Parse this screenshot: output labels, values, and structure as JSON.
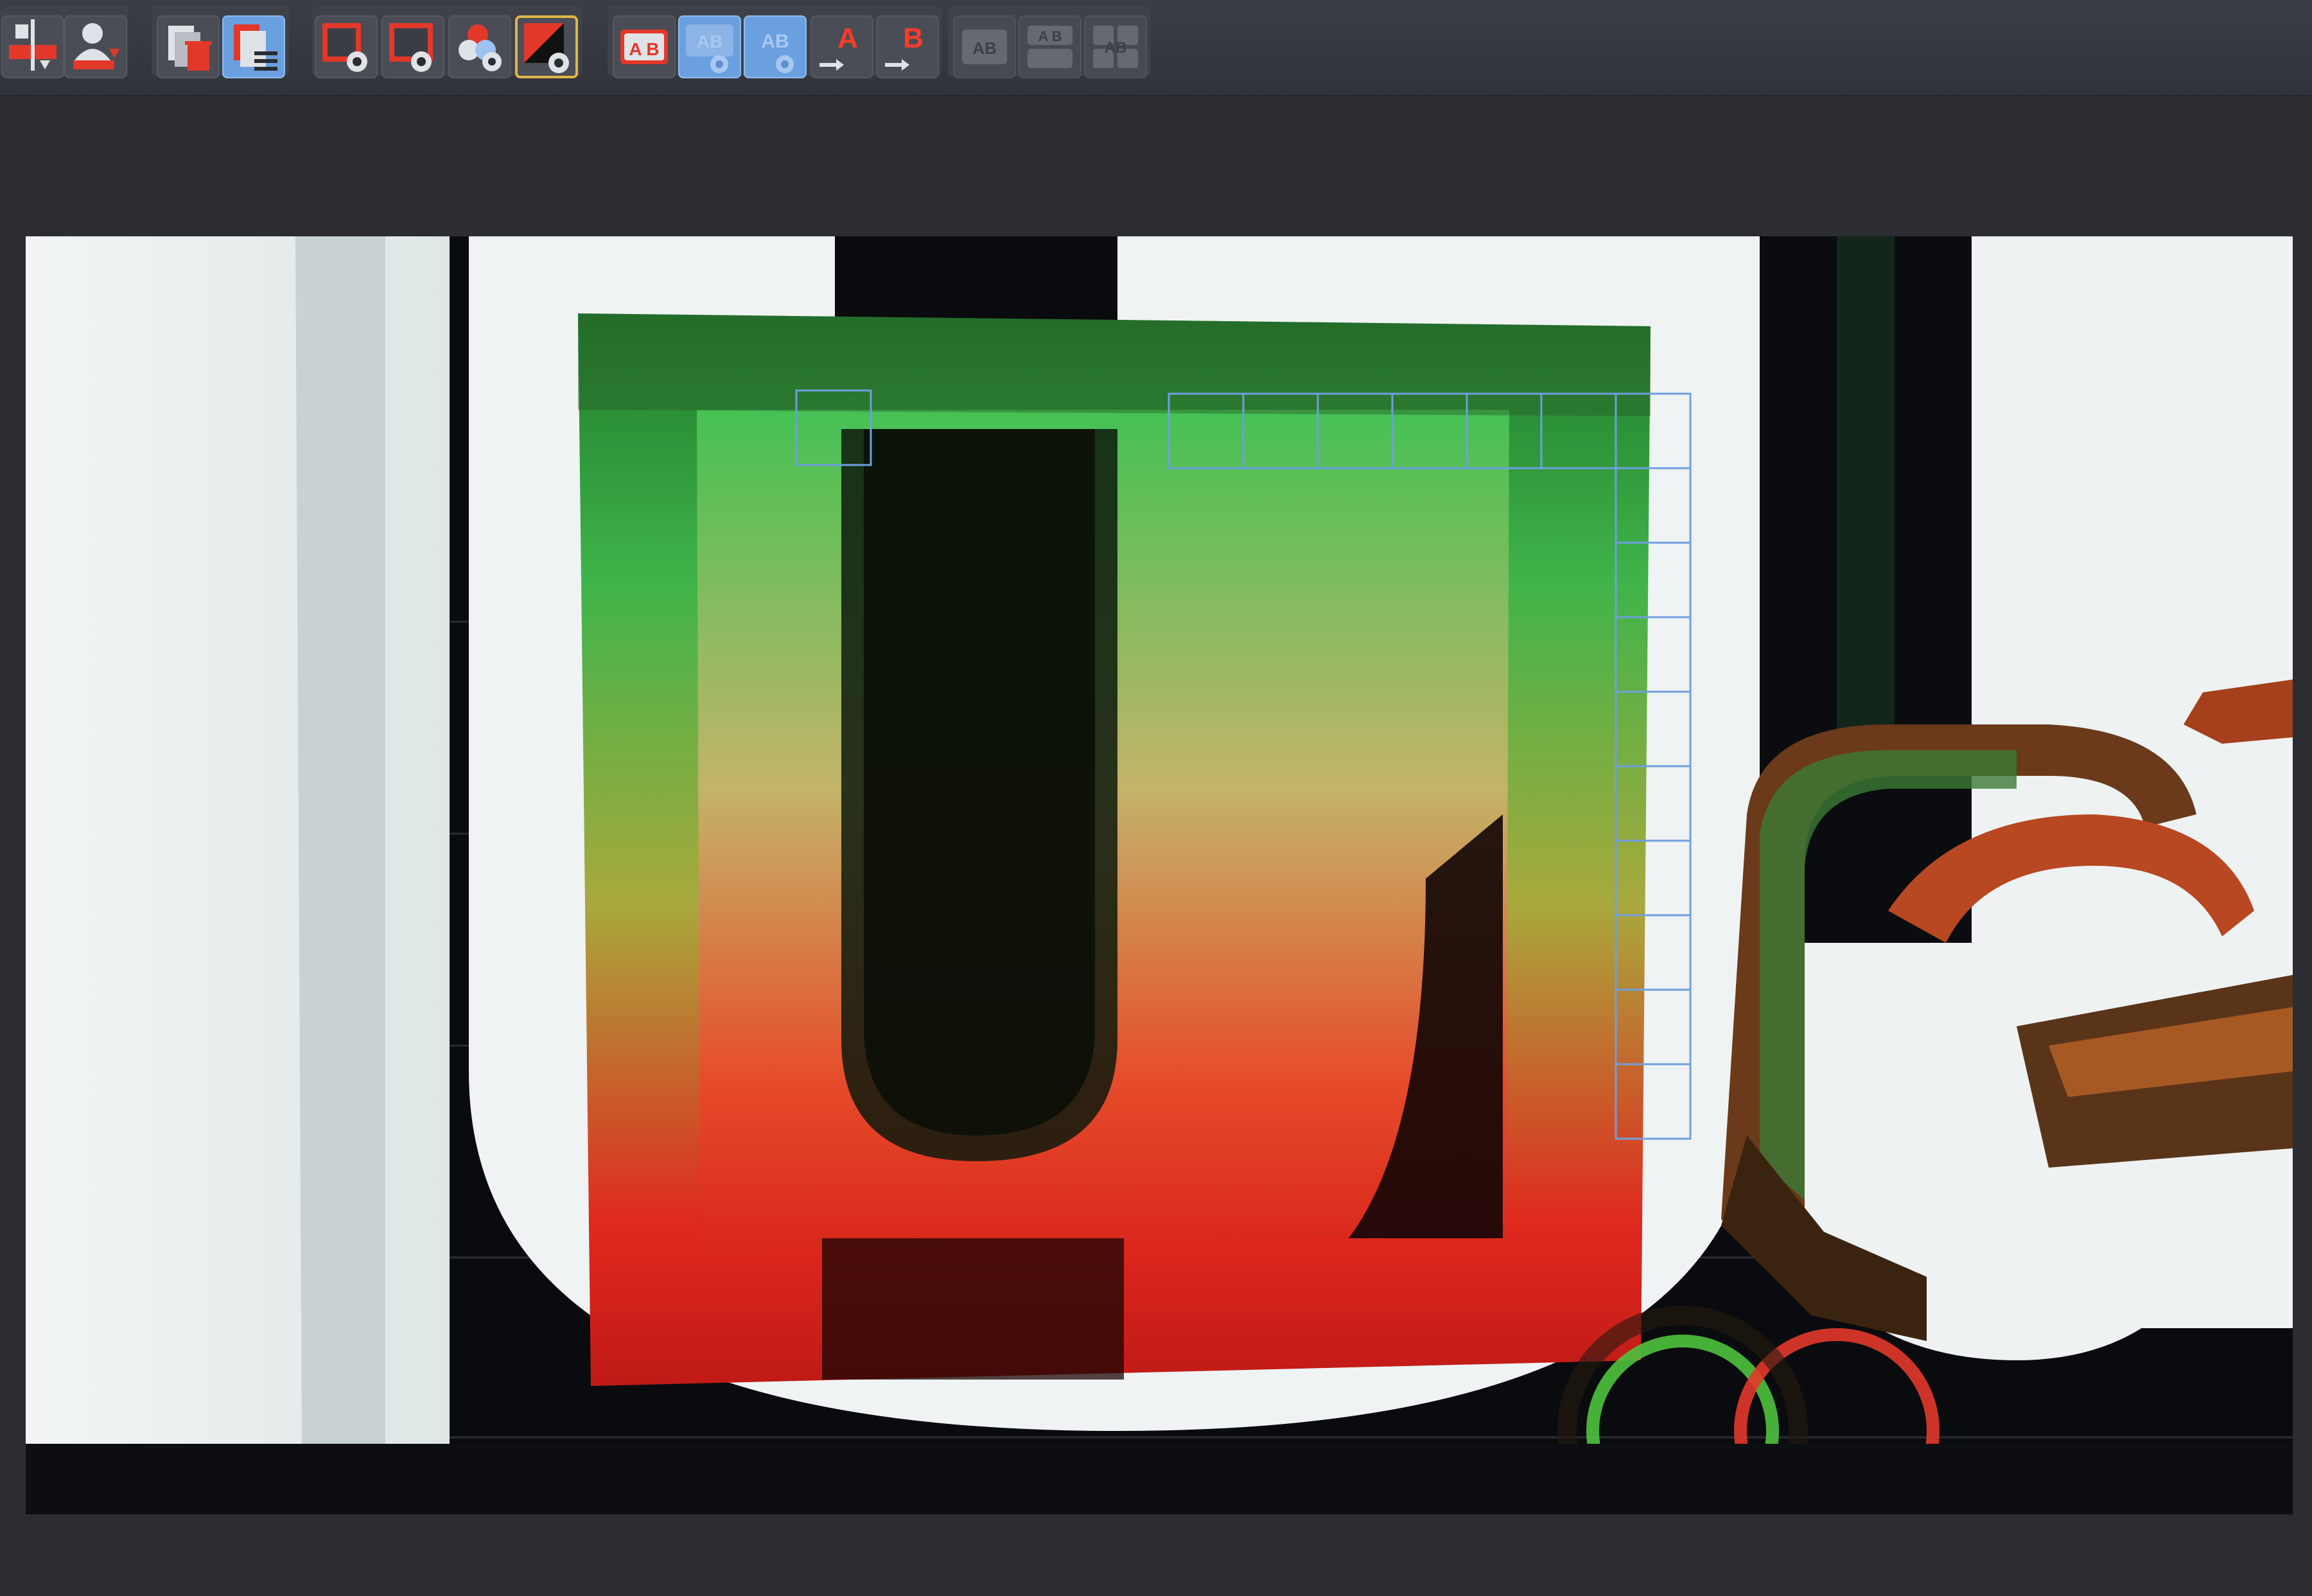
{
  "toolbar": {
    "groups": [
      {
        "name": "layout-group",
        "buttons": [
          {
            "id": "align-button",
            "icon": "align-icon",
            "state": "normal"
          },
          {
            "id": "user-down-button",
            "icon": "user-arrow-down-icon",
            "state": "normal"
          }
        ]
      },
      {
        "name": "copy-group",
        "buttons": [
          {
            "id": "delete-copy-button",
            "icon": "copy-trash-icon",
            "state": "normal"
          },
          {
            "id": "list-copy-button",
            "icon": "copy-list-icon",
            "state": "active"
          }
        ]
      },
      {
        "name": "view-group",
        "buttons": [
          {
            "id": "view-frame-button",
            "icon": "frame-eye-icon",
            "state": "normal"
          },
          {
            "id": "view-frame-alt-button",
            "icon": "frame-eye-alt-icon",
            "state": "normal"
          },
          {
            "id": "view-color-button",
            "icon": "color-circles-eye-icon",
            "state": "normal"
          },
          {
            "id": "view-contrast-button",
            "icon": "contrast-eye-icon",
            "state": "normal"
          }
        ]
      },
      {
        "name": "compare-group",
        "buttons": [
          {
            "id": "ab-button",
            "icon": "ab-icon",
            "label": "A B",
            "state": "normal"
          },
          {
            "id": "ab-view-button",
            "icon": "ab-eye-icon",
            "label": "AB",
            "state": "active"
          },
          {
            "id": "ab-view-alt-button",
            "icon": "ab-eye-alt-icon",
            "label": "AB",
            "state": "active"
          },
          {
            "id": "set-a-button",
            "icon": "arrow-a-icon",
            "label": "A",
            "state": "normal"
          },
          {
            "id": "set-b-button",
            "icon": "arrow-b-icon",
            "label": "B",
            "state": "normal"
          }
        ]
      },
      {
        "name": "split-group",
        "buttons": [
          {
            "id": "split-side-button",
            "icon": "split-side-icon",
            "label": "AB",
            "state": "disabled"
          },
          {
            "id": "split-stack-button",
            "icon": "split-stack-icon",
            "label": "A B",
            "state": "disabled"
          },
          {
            "id": "split-quad-button",
            "icon": "split-quad-icon",
            "label": "AB",
            "state": "disabled"
          }
        ]
      }
    ]
  },
  "labels": {
    "a": "A",
    "b": "B",
    "ab": "AB",
    "a_b": "A B"
  },
  "viewport": {
    "content": "3d-render",
    "colors": {
      "background": "#0b0c0f",
      "wall": "#e9eeee",
      "overlay_green": "#2fa33a",
      "overlay_red": "#e0231c",
      "selection": "#6f9fe0"
    }
  }
}
